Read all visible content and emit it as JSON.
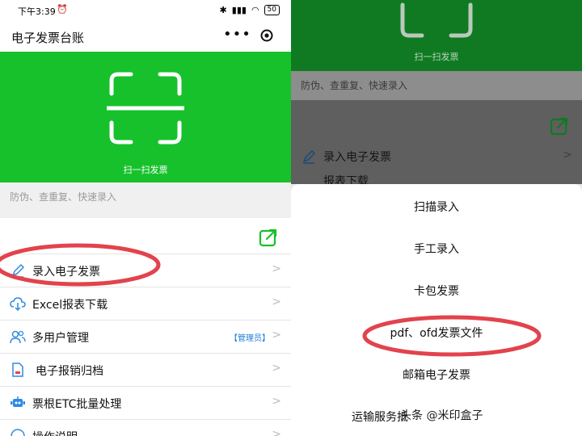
{
  "status": {
    "time": "下午3:39",
    "battery": "50"
  },
  "app": {
    "title": "电子发票台账"
  },
  "banner": {
    "scan_label": "扫一扫发票",
    "tagline": "防伪、查重复、快速录入"
  },
  "menu": [
    {
      "label": "录入电子发票",
      "badge": ""
    },
    {
      "label": "Excel报表下载",
      "badge": ""
    },
    {
      "label": "多用户管理",
      "badge": "【管理员】"
    },
    {
      "label": "电子报销归档",
      "badge": ""
    },
    {
      "label": "票根ETC批量处理",
      "badge": ""
    },
    {
      "label": "操作说明",
      "badge": ""
    }
  ],
  "right": {
    "scan_label": "扫一扫发票",
    "tagline": "防伪、查重复、快速录入",
    "menu_item": "录入电子发票",
    "menu_peek": "报表下载",
    "sheet_options": [
      "扫描录入",
      "手工录入",
      "卡包发票",
      "pdf、ofd发票文件",
      "邮箱电子发票",
      "运输服务抵"
    ],
    "watermark": "头条 @米印盒子"
  },
  "colors": {
    "brand_green": "#17c12b",
    "annotation_red": "#e2434c",
    "badge_blue": "#1e7bd8"
  }
}
